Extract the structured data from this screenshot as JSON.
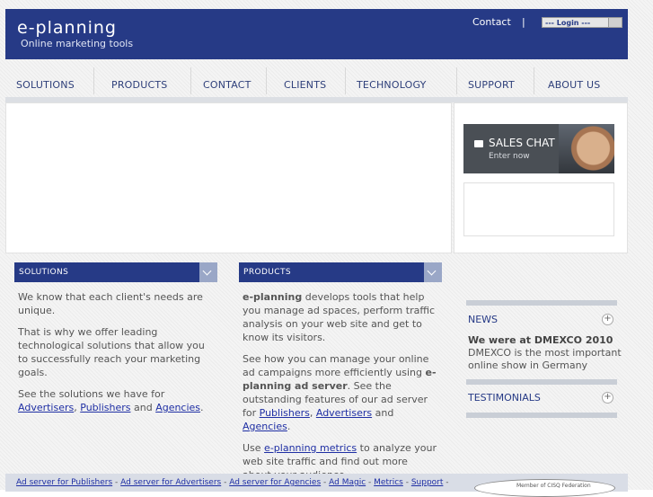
{
  "header": {
    "logo": "e-planning",
    "tagline": "Online marketing tools",
    "contact_link": "Contact",
    "separator": "|",
    "login_select_value": "--- Login ---"
  },
  "nav": {
    "items": [
      "SOLUTIONS",
      "PRODUCTS",
      "CONTACT",
      "CLIENTS",
      "TECHNOLOGY",
      "SUPPORT",
      "ABOUT US"
    ]
  },
  "sales_chat": {
    "title": "SALES CHAT",
    "subtitle": "Enter now"
  },
  "solutions": {
    "heading": "SOLUTIONS",
    "p1": "We know that each client's needs are unique.",
    "p2": "That is why we offer leading technological solutions that allow you to successfully reach your marketing goals.",
    "p3_prefix": "See the solutions we have for ",
    "link_advertisers": "Advertisers",
    "comma": ", ",
    "link_publishers": "Publishers",
    "and": " and ",
    "link_agencies": "Agencies",
    "period": "."
  },
  "products": {
    "heading": "PRODUCTS",
    "p1_bold": "e-planning",
    "p1_rest": " develops tools that help you manage ad spaces, perform traffic analysis on your web site and get to know its visitors.",
    "p2_prefix": "See how you can manage your online ad campaigns more efficiently using ",
    "p2_bold": "e-planning ad server",
    "p2_mid": ". See the outstanding features of our ad server for ",
    "link_publishers": "Publishers",
    "comma": ", ",
    "link_advertisers": "Advertisers",
    "and": " and ",
    "link_agencies": "Agencies",
    "period": ".",
    "p3_prefix": "Use ",
    "link_metrics": "e-planning metrics",
    "p3_rest": " to analyze your web site traffic and find out more about your audience."
  },
  "sidebar": {
    "news_label": "NEWS",
    "news_title": "We were at DMEXCO 2010",
    "news_text": "DMEXCO is the most important online show in Germany",
    "testimonials_label": "TESTIMONIALS",
    "plus": "+"
  },
  "footer": {
    "link1": "Ad server for Publishers",
    "link2": "Ad server for Advertisers",
    "link3": "Ad server for Agencies",
    "link4": "Ad Magic",
    "link5": "Metrics",
    "link6": "Support",
    "dash": " - ",
    "cisq": "Member of CISQ Federation"
  }
}
